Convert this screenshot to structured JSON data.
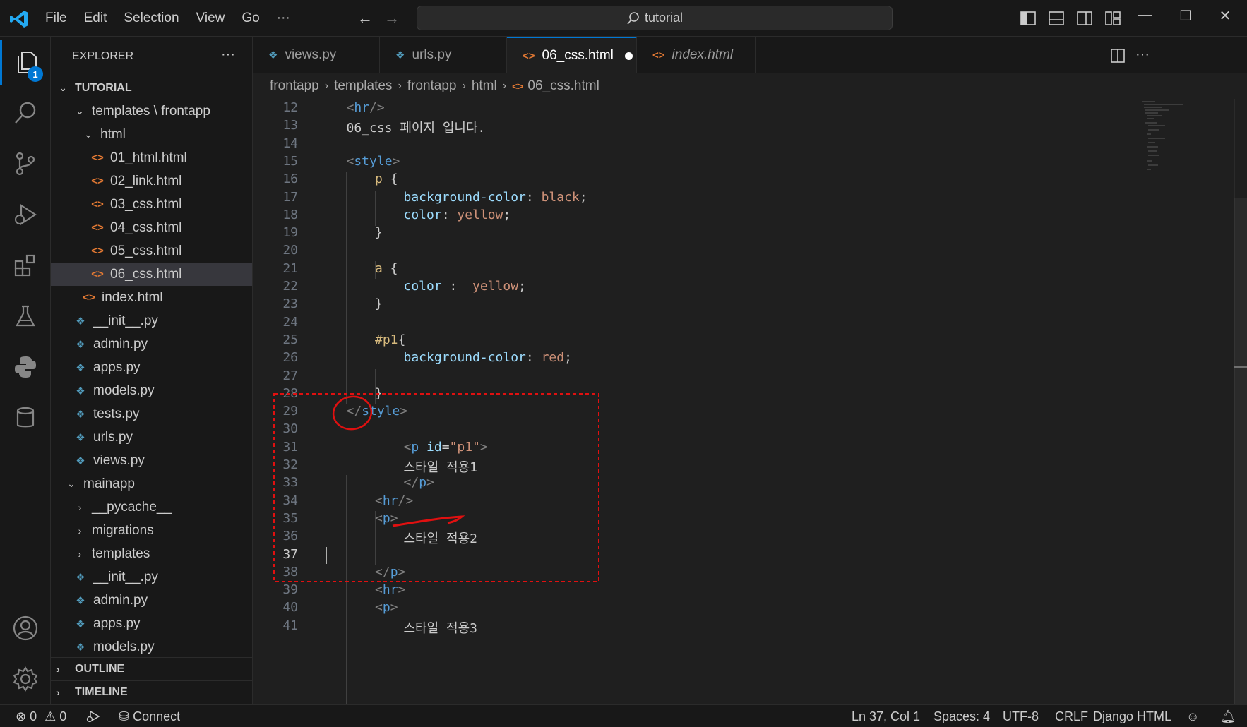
{
  "titlebar": {
    "menu": [
      "File",
      "Edit",
      "Selection",
      "View",
      "Go",
      "···"
    ],
    "search_text": "tutorial",
    "nav_back": "←",
    "nav_forward": "→",
    "win_minimize": "—",
    "win_maximize": "☐",
    "win_close": "✕"
  },
  "activity": {
    "explorer_badge": "1",
    "icons": [
      "files-icon",
      "search-icon",
      "source-control-icon",
      "run-debug-icon",
      "extensions-icon",
      "testing-icon",
      "python-icon",
      "database-icon",
      "account-icon",
      "settings-gear-icon"
    ]
  },
  "sidebar": {
    "header": "EXPLORER",
    "more": "···",
    "root": "TUTORIAL",
    "tree": [
      {
        "label": "templates \\ frontapp",
        "kind": "folder-open"
      },
      {
        "label": "html",
        "kind": "folder-open"
      },
      {
        "label": "01_html.html",
        "kind": "html"
      },
      {
        "label": "02_link.html",
        "kind": "html"
      },
      {
        "label": "03_css.html",
        "kind": "html"
      },
      {
        "label": "04_css.html",
        "kind": "html"
      },
      {
        "label": "05_css.html",
        "kind": "html"
      },
      {
        "label": "06_css.html",
        "kind": "html",
        "selected": true
      },
      {
        "label": "index.html",
        "kind": "html"
      },
      {
        "label": "__init__.py",
        "kind": "py"
      },
      {
        "label": "admin.py",
        "kind": "py"
      },
      {
        "label": "apps.py",
        "kind": "py"
      },
      {
        "label": "models.py",
        "kind": "py"
      },
      {
        "label": "tests.py",
        "kind": "py"
      },
      {
        "label": "urls.py",
        "kind": "py"
      },
      {
        "label": "views.py",
        "kind": "py"
      },
      {
        "label": "mainapp",
        "kind": "folder-open"
      },
      {
        "label": "__pycache__",
        "kind": "folder-closed"
      },
      {
        "label": "migrations",
        "kind": "folder-closed"
      },
      {
        "label": "templates",
        "kind": "folder-closed"
      },
      {
        "label": "__init__.py",
        "kind": "py"
      },
      {
        "label": "admin.py",
        "kind": "py"
      },
      {
        "label": "apps.py",
        "kind": "py"
      },
      {
        "label": "models.py",
        "kind": "py"
      }
    ],
    "outline": "OUTLINE",
    "timeline": "TIMELINE"
  },
  "tabs": [
    {
      "label": "views.py",
      "kind": "py"
    },
    {
      "label": "urls.py",
      "kind": "py"
    },
    {
      "label": "06_css.html",
      "kind": "html",
      "active": true,
      "dirty": true
    },
    {
      "label": "index.html",
      "kind": "html",
      "italic": true
    }
  ],
  "tab_actions": {
    "split": "split-editor-icon",
    "more": "···"
  },
  "breadcrumb": [
    "frontapp",
    "templates",
    "frontapp",
    "html",
    "06_css.html"
  ],
  "editor": {
    "current_line": 37,
    "lines": [
      {
        "n": 12,
        "tokens": [
          [
            "tg",
            "<"
          ],
          [
            "tn",
            "hr"
          ],
          [
            "tg",
            "/>"
          ]
        ],
        "indent": 1
      },
      {
        "n": 13,
        "tokens": [
          [
            "pl",
            "06_css 페이지 입니다."
          ]
        ],
        "indent": 1
      },
      {
        "n": 14,
        "tokens": [],
        "indent": 0
      },
      {
        "n": 15,
        "tokens": [
          [
            "tg",
            "<"
          ],
          [
            "tn",
            "style"
          ],
          [
            "tg",
            ">"
          ]
        ],
        "indent": 1
      },
      {
        "n": 16,
        "tokens": [
          [
            "sel",
            "p"
          ],
          [
            "pl",
            " {"
          ]
        ],
        "indent": 2
      },
      {
        "n": 17,
        "tokens": [
          [
            "pr",
            "background-color"
          ],
          [
            "pl",
            ": "
          ],
          [
            "vl",
            "black"
          ],
          [
            "pl",
            ";"
          ]
        ],
        "indent": 3
      },
      {
        "n": 18,
        "tokens": [
          [
            "pr",
            "color"
          ],
          [
            "pl",
            ": "
          ],
          [
            "vl",
            "yellow"
          ],
          [
            "pl",
            ";"
          ]
        ],
        "indent": 3
      },
      {
        "n": 19,
        "tokens": [
          [
            "pl",
            "}"
          ]
        ],
        "indent": 2
      },
      {
        "n": 20,
        "tokens": [],
        "indent": 0
      },
      {
        "n": 21,
        "tokens": [
          [
            "sel",
            "a"
          ],
          [
            "pl",
            " {"
          ]
        ],
        "indent": 2
      },
      {
        "n": 22,
        "tokens": [
          [
            "pr",
            "color"
          ],
          [
            "pl",
            " :  "
          ],
          [
            "vl",
            "yellow"
          ],
          [
            "pl",
            ";"
          ]
        ],
        "indent": 3
      },
      {
        "n": 23,
        "tokens": [
          [
            "pl",
            "}"
          ]
        ],
        "indent": 2
      },
      {
        "n": 24,
        "tokens": [],
        "indent": 0
      },
      {
        "n": 25,
        "tokens": [
          [
            "sel",
            "#p1"
          ],
          [
            "pl",
            "{"
          ]
        ],
        "indent": 2
      },
      {
        "n": 26,
        "tokens": [
          [
            "pr",
            "background-color"
          ],
          [
            "pl",
            ": "
          ],
          [
            "vl",
            "red"
          ],
          [
            "pl",
            ";"
          ]
        ],
        "indent": 3
      },
      {
        "n": 27,
        "tokens": [],
        "indent": 0
      },
      {
        "n": 28,
        "tokens": [
          [
            "pl",
            "}"
          ]
        ],
        "indent": 2
      },
      {
        "n": 29,
        "tokens": [
          [
            "tg",
            "</"
          ],
          [
            "tn",
            "style"
          ],
          [
            "tg",
            ">"
          ]
        ],
        "indent": 1
      },
      {
        "n": 30,
        "tokens": [],
        "indent": 0
      },
      {
        "n": 31,
        "tokens": [
          [
            "tg",
            "<"
          ],
          [
            "tn",
            "p"
          ],
          [
            "pl",
            " "
          ],
          [
            "at",
            "id"
          ],
          [
            "pl",
            "="
          ],
          [
            "sv",
            "\"p1\""
          ],
          [
            "tg",
            ">"
          ]
        ],
        "indent": 3
      },
      {
        "n": 32,
        "tokens": [
          [
            "pl",
            "스타일 적용1"
          ]
        ],
        "indent": 3
      },
      {
        "n": 33,
        "tokens": [
          [
            "tg",
            "</"
          ],
          [
            "tn",
            "p"
          ],
          [
            "tg",
            ">"
          ]
        ],
        "indent": 3
      },
      {
        "n": 34,
        "tokens": [
          [
            "tg",
            "<"
          ],
          [
            "tn",
            "hr"
          ],
          [
            "tg",
            "/>"
          ]
        ],
        "indent": 2
      },
      {
        "n": 35,
        "tokens": [
          [
            "tg",
            "<"
          ],
          [
            "tn",
            "p"
          ],
          [
            "tg",
            ">"
          ]
        ],
        "indent": 2
      },
      {
        "n": 36,
        "tokens": [
          [
            "pl",
            "스타일 적용2"
          ]
        ],
        "indent": 3
      },
      {
        "n": 37,
        "tokens": [],
        "indent": 0
      },
      {
        "n": 38,
        "tokens": [
          [
            "tg",
            "</"
          ],
          [
            "tn",
            "p"
          ],
          [
            "tg",
            ">"
          ]
        ],
        "indent": 2
      },
      {
        "n": 39,
        "tokens": [
          [
            "tg",
            "<"
          ],
          [
            "tn",
            "hr"
          ],
          [
            "tg",
            ">"
          ]
        ],
        "indent": 2
      },
      {
        "n": 40,
        "tokens": [
          [
            "tg",
            "<"
          ],
          [
            "tn",
            "p"
          ],
          [
            "tg",
            ">"
          ]
        ],
        "indent": 2
      },
      {
        "n": 41,
        "tokens": [
          [
            "pl",
            "스타일 적용3"
          ]
        ],
        "indent": 3
      }
    ]
  },
  "statusbar": {
    "errors": "0",
    "warnings": "0",
    "connect": "Connect",
    "position": "Ln 37, Col 1",
    "spaces": "Spaces: 4",
    "encoding": "UTF-8",
    "eol": "CRLF",
    "language": "Django HTML"
  },
  "colors": {
    "accent": "#0078d4",
    "annotation_red": "#e01010"
  }
}
